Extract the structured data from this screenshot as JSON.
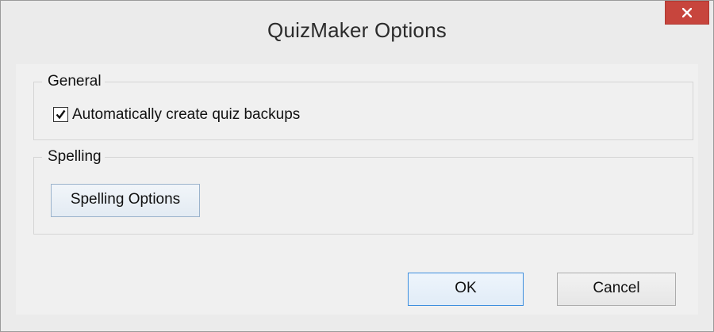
{
  "window": {
    "title": "QuizMaker Options",
    "close_icon": "close-icon"
  },
  "general": {
    "legend": "General",
    "backup_checkbox": {
      "label": "Automatically create quiz backups",
      "checked": true
    }
  },
  "spelling": {
    "legend": "Spelling",
    "options_button": "Spelling Options"
  },
  "footer": {
    "ok_label": "OK",
    "cancel_label": "Cancel"
  },
  "colors": {
    "close_button": "#c7453d",
    "default_button_border": "#3c8ede"
  }
}
